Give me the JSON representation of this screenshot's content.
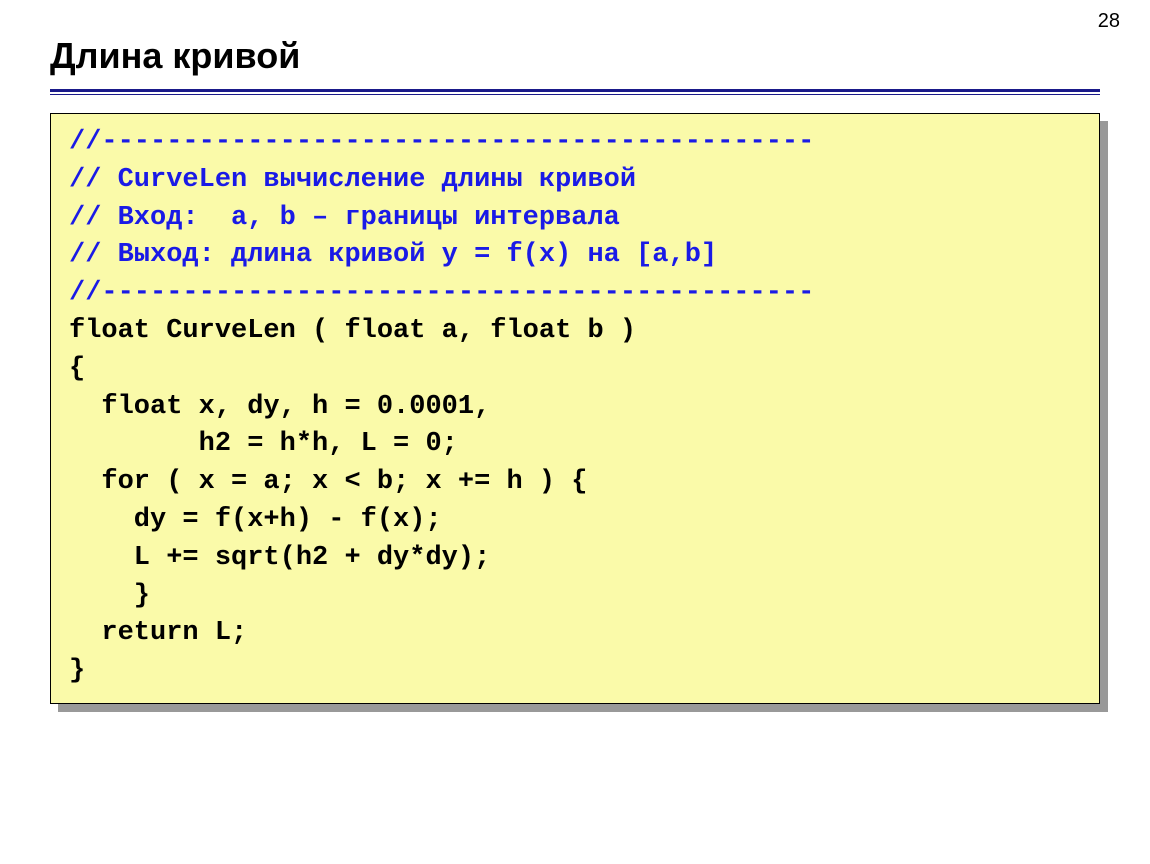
{
  "page_number": "28",
  "title": "Длина кривой",
  "code": {
    "c1": "//--------------------------------------------",
    "c2": "// CurveLen вычисление длины кривой",
    "c3": "// Вход:  a, b – границы интервала",
    "c4": "// Выход: длина кривой y = f(x) на [a,b]",
    "c5": "//--------------------------------------------",
    "l1": "float CurveLen ( float a, float b )",
    "l2": "{",
    "l3": "  float x, dy, h = 0.0001,",
    "l4": "        h2 = h*h, L = 0;",
    "l5": "  for ( x = a; x < b; x += h ) {",
    "l6": "    dy = f(x+h) - f(x);",
    "l7": "    L += sqrt(h2 + dy*dy);",
    "l8": "    }",
    "l9": "  return L;",
    "l10": "}"
  }
}
